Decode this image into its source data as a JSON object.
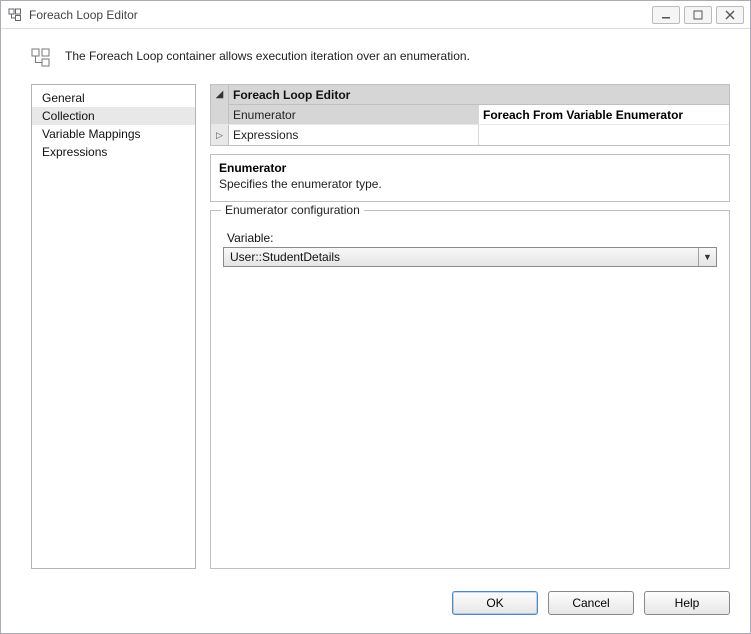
{
  "window": {
    "title": "Foreach Loop Editor"
  },
  "header": {
    "description": "The Foreach Loop container allows execution iteration over an enumeration."
  },
  "nav": {
    "items": [
      {
        "label": "General"
      },
      {
        "label": "Collection"
      },
      {
        "label": "Variable Mappings"
      },
      {
        "label": "Expressions"
      }
    ],
    "selected_index": 1
  },
  "property_grid": {
    "category": "Foreach Loop Editor",
    "rows": [
      {
        "name": "Enumerator",
        "value": "Foreach From Variable Enumerator",
        "bold": true,
        "gutter": ""
      },
      {
        "name": "Expressions",
        "value": "",
        "bold": false,
        "gutter": "▷"
      }
    ]
  },
  "description_panel": {
    "title": "Enumerator",
    "text": "Specifies the enumerator type."
  },
  "enum_config": {
    "legend": "Enumerator configuration",
    "variable_label": "Variable:",
    "variable_value": "User::StudentDetails"
  },
  "buttons": {
    "ok": "OK",
    "cancel": "Cancel",
    "help": "Help"
  }
}
